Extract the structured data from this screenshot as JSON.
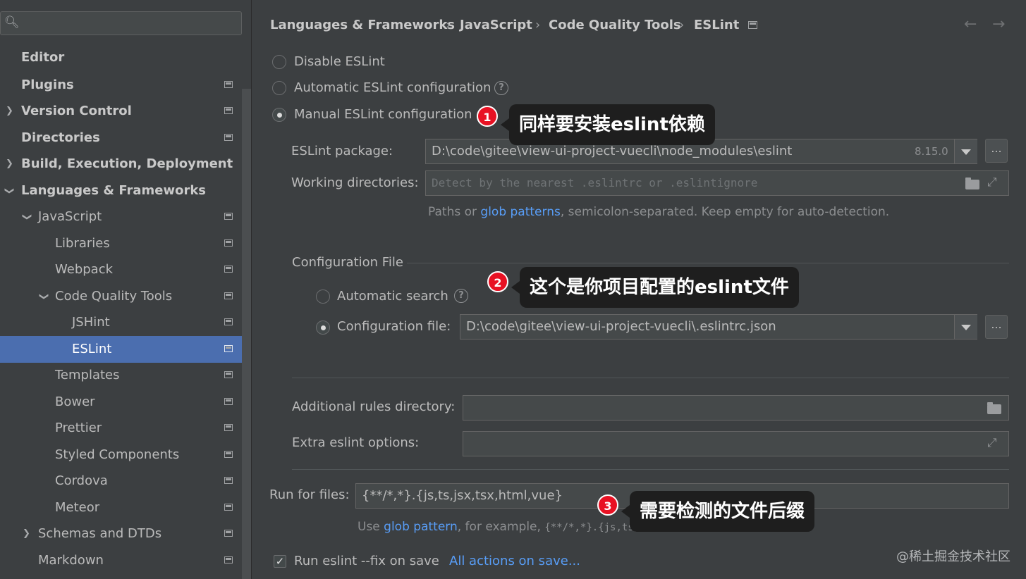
{
  "search": {
    "placeholder": ""
  },
  "sidebar": {
    "items": [
      {
        "label": "Editor",
        "bold": true
      },
      {
        "label": "Plugins",
        "bold": true
      },
      {
        "label": "Version Control",
        "bold": true
      },
      {
        "label": "Directories",
        "bold": true
      },
      {
        "label": "Build, Execution, Deployment",
        "bold": true
      },
      {
        "label": "Languages & Frameworks",
        "bold": true
      },
      {
        "label": "JavaScript"
      },
      {
        "label": "Libraries"
      },
      {
        "label": "Webpack"
      },
      {
        "label": "Code Quality Tools"
      },
      {
        "label": "JSHint"
      },
      {
        "label": "ESLint",
        "selected": true
      },
      {
        "label": "Templates"
      },
      {
        "label": "Bower"
      },
      {
        "label": "Prettier"
      },
      {
        "label": "Styled Components"
      },
      {
        "label": "Cordova"
      },
      {
        "label": "Meteor"
      },
      {
        "label": "Schemas and DTDs"
      },
      {
        "label": "Markdown"
      }
    ]
  },
  "breadcrumb": [
    "Languages & Frameworks",
    "JavaScript",
    "Code Quality Tools",
    "ESLint"
  ],
  "breadcrumb_sep": "›",
  "nav": {
    "back": "←",
    "forward": "→"
  },
  "eslint": {
    "disable_label": "Disable ESLint",
    "automatic_label": "Automatic ESLint configuration",
    "manual_label": "Manual ESLint configuration",
    "selected_mode": "manual",
    "package_label": "ESLint package:",
    "package_value": "D:\\code\\gitee\\view-ui-project-vuecli\\node_modules\\eslint",
    "package_version": "8.15.0",
    "workdir_label": "Working directories:",
    "workdir_placeholder": "Detect by the nearest .eslintrc or .eslintignore",
    "workdir_hint_prefix": "Paths or",
    "workdir_hint_link": "glob patterns",
    "workdir_hint_suffix": ", semicolon-separated. Keep empty for auto-detection.",
    "config_section": "Configuration File",
    "auto_search_label": "Automatic search",
    "config_file_label": "Configuration file:",
    "config_file_value": "D:\\code\\gitee\\view-ui-project-vuecli\\.eslintrc.json",
    "rules_dir_label": "Additional rules directory:",
    "rules_dir_value": "",
    "extra_options_label": "Extra eslint options:",
    "extra_options_value": "",
    "run_for_files_label": "Run for files:",
    "run_for_files_value": "{**/*,*}.{js,ts,jsx,tsx,html,vue}",
    "run_hint_prefix": "Use",
    "run_hint_link": "glob pattern",
    "run_hint_suffix": ", for example,",
    "run_hint_example": "{**/*,*}.{js,ts}",
    "fix_on_save_label": "Run eslint --fix on save",
    "fix_on_save_checked": true,
    "all_actions_link": "All actions on save..."
  },
  "annotations": [
    {
      "num": "1",
      "text": "同样要安装eslint依赖"
    },
    {
      "num": "2",
      "text": "这个是你项目配置的eslint文件"
    },
    {
      "num": "3",
      "text": "需要检测的文件后缀"
    }
  ],
  "watermark": "@稀土掘金技术社区",
  "colors": {
    "selection": "#4b6eaf",
    "link": "#589df6",
    "badge": "#e81123",
    "background": "#3c3f41"
  }
}
